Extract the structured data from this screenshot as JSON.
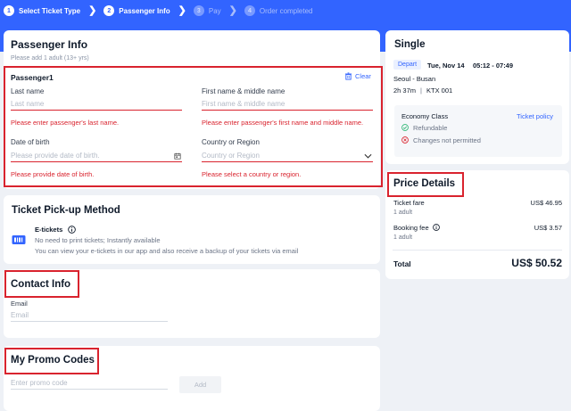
{
  "steps": [
    {
      "num": "1",
      "label": "Select Ticket Type",
      "state": "done"
    },
    {
      "num": "2",
      "label": "Passenger Info",
      "state": "active"
    },
    {
      "num": "3",
      "label": "Pay",
      "state": "pending"
    },
    {
      "num": "4",
      "label": "Order completed",
      "state": "pending"
    }
  ],
  "passenger": {
    "title": "Passenger Info",
    "note": "Please add 1 adult (13+ yrs)",
    "subtitle": "Passenger1",
    "clear_label": "Clear",
    "last_name": {
      "label": "Last name",
      "placeholder": "Last name",
      "error": "Please enter passenger's last name."
    },
    "first_name": {
      "label": "First name & middle name",
      "placeholder": "First name & middle name",
      "error": "Please enter passenger's first name and middle name."
    },
    "dob": {
      "label": "Date of birth",
      "placeholder": "Please provide date of birth.",
      "error": "Please provide date of birth."
    },
    "country": {
      "label": "Country or Region",
      "placeholder": "Country or Region",
      "error": "Please select a country or region."
    }
  },
  "pickup": {
    "title": "Ticket Pick-up Method",
    "option_title": "E-tickets",
    "line1": "No need to print tickets; Instantly available",
    "line2": "You can view your e-tickets in our app and also receive a backup of your tickets via email"
  },
  "contact": {
    "title": "Contact Info",
    "email_label": "Email",
    "email_placeholder": "Email"
  },
  "promo": {
    "title": "My Promo Codes",
    "placeholder": "Enter promo code",
    "add_label": "Add"
  },
  "trip": {
    "title": "Single",
    "badge": "Depart",
    "date": "Tue, Nov 14",
    "time": "05:12 - 07:49",
    "route": "Seoul - Busan",
    "duration": "2h 37m",
    "train": "KTX 001",
    "class": "Economy Class",
    "policy_link": "Ticket policy",
    "refund": "Refundable",
    "changes": "Changes not permitted"
  },
  "price": {
    "title": "Price Details",
    "fare_label": "Ticket fare",
    "fare_value": "US$ 46.95",
    "fare_sub": "1 adult",
    "fee_label": "Booking fee",
    "fee_value": "US$ 3.57",
    "fee_sub": "1 adult",
    "total_label": "Total",
    "total_value": "US$ 50.52"
  },
  "colors": {
    "accent": "#3264ff",
    "error": "#d9232e",
    "success": "#2bb673"
  }
}
